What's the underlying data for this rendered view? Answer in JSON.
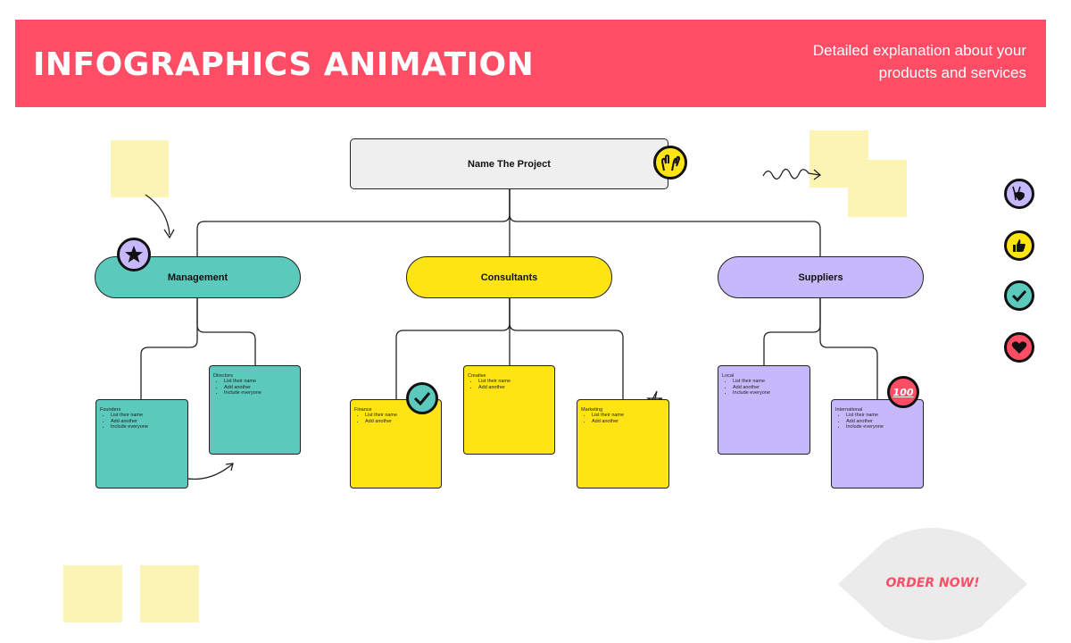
{
  "header": {
    "title": "INFOGRAPHICS ANIMATION",
    "subtitle_line1": "Detailed explanation about your",
    "subtitle_line2": "products and services"
  },
  "root": {
    "label": "Name The Project",
    "icon": "raised-hands-icon"
  },
  "groups": [
    {
      "label": "Management",
      "color": "#5bc9bc",
      "badge_icon": "star-icon"
    },
    {
      "label": "Consultants",
      "color": "#ffe414"
    },
    {
      "label": "Suppliers",
      "color": "#c6b9fb"
    }
  ],
  "cards": {
    "founders": {
      "title": "Founders",
      "items": [
        "List their name",
        "Add another",
        "Include everyone"
      ]
    },
    "directors": {
      "title": "Directors",
      "items": [
        "List their name",
        "Add another",
        "Include everyone"
      ]
    },
    "finance": {
      "title": "Finance",
      "items": [
        "List their name",
        "Add another"
      ]
    },
    "creative": {
      "title": "Creative",
      "items": [
        "List their name",
        "Add another"
      ]
    },
    "marketing": {
      "title": "Marketing",
      "items": [
        "List their name",
        "Add another"
      ]
    },
    "local": {
      "title": "Local",
      "items": [
        "List their name",
        "Add another",
        "Include everyone"
      ]
    },
    "international": {
      "title": "International",
      "items": [
        "List their name",
        "Add another",
        "Include everyone"
      ]
    }
  },
  "sidebar_icons": [
    "peace-hand-icon",
    "thumbs-up-icon",
    "check-icon",
    "heart-icon"
  ],
  "badge_100": "100",
  "order_button": {
    "label": "ORDER NOW!"
  },
  "colors": {
    "accent": "#ff4d66",
    "teal": "#5bc9bc",
    "yellow": "#ffe414",
    "purple": "#c6b9fb",
    "sticky": "#fbf4b4"
  }
}
